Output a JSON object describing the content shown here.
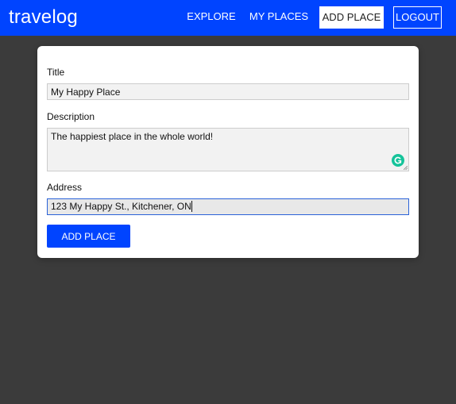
{
  "navbar": {
    "brand": "travelog",
    "links": {
      "explore": "EXPLORE",
      "my_places": "MY PLACES",
      "add_place": "ADD PLACE",
      "logout": "LOGOUT"
    },
    "active_link": "add_place",
    "background_color": "#0044ff"
  },
  "form": {
    "title": {
      "label": "Title",
      "value": "My Happy Place"
    },
    "description": {
      "label": "Description",
      "value": "The happiest place in the whole world!"
    },
    "address": {
      "label": "Address",
      "value": "123 My Happy St., Kitchener, ON",
      "focused": true
    },
    "submit_label": "ADD PLACE"
  },
  "icons": {
    "grammarly": "grammarly-icon",
    "resize": "resize-grip-icon"
  },
  "colors": {
    "accent": "#0044ff",
    "page_background": "#3b3b3b",
    "grammarly": "#15c39a",
    "focus_border": "#2a62d8"
  }
}
